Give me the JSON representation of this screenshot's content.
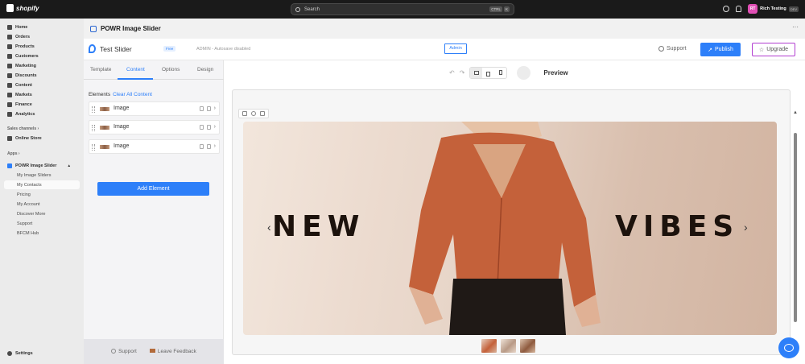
{
  "topbar": {
    "brand": "shopify",
    "search_placeholder": "Search",
    "shortcut_keys": [
      "CTRL",
      "K"
    ],
    "user_initials": "RT",
    "user_name": "Rich Testing",
    "user_badge": "DEV"
  },
  "sidebar": {
    "main_items": [
      {
        "label": "Home",
        "icon": "home-icon"
      },
      {
        "label": "Orders",
        "icon": "orders-icon"
      },
      {
        "label": "Products",
        "icon": "products-icon"
      },
      {
        "label": "Customers",
        "icon": "customers-icon"
      },
      {
        "label": "Marketing",
        "icon": "marketing-icon"
      },
      {
        "label": "Discounts",
        "icon": "discounts-icon"
      },
      {
        "label": "Content",
        "icon": "content-icon"
      },
      {
        "label": "Markets",
        "icon": "markets-icon"
      },
      {
        "label": "Finance",
        "icon": "finance-icon"
      },
      {
        "label": "Analytics",
        "icon": "analytics-icon"
      }
    ],
    "sales_channels_label": "Sales channels",
    "online_store": "Online Store",
    "apps_label": "Apps",
    "active_app": "POWR Image Slider",
    "app_subitems": [
      "My Image Sliders",
      "My Contacts",
      "Pricing",
      "My Account",
      "Discover More",
      "Support",
      "BFCM Hub"
    ],
    "settings": "Settings"
  },
  "app": {
    "title": "POWR Image Slider",
    "more": "···"
  },
  "powr_header": {
    "slider_name": "Test Slider",
    "plan_badge": "Free",
    "admin_note": "ADMIN - Autosave disabled",
    "admin_button": "Admin",
    "support": "Support",
    "publish": "Publish",
    "upgrade": "Upgrade"
  },
  "editor": {
    "tabs": [
      "Template",
      "Content",
      "Options",
      "Design"
    ],
    "active_tab": "Content",
    "elements_label": "Elements",
    "clear_link": "Clear All Content",
    "elements": [
      "Image",
      "Image",
      "Image"
    ],
    "add_element": "Add Element",
    "footer_support": "Support",
    "footer_feedback": "Leave Feedback"
  },
  "preview": {
    "undo": "↶",
    "redo": "↷",
    "label": "Preview",
    "slide_text_left": "NEW",
    "slide_text_right": "VIBES",
    "arrow_left": "‹",
    "arrow_right": "›",
    "thumbnail_count": 3
  },
  "colors": {
    "accent": "#2d7ff9",
    "upgrade_border": "#b23ed1",
    "avatar": "#e14fb5",
    "topbar": "#1a1a1a"
  }
}
